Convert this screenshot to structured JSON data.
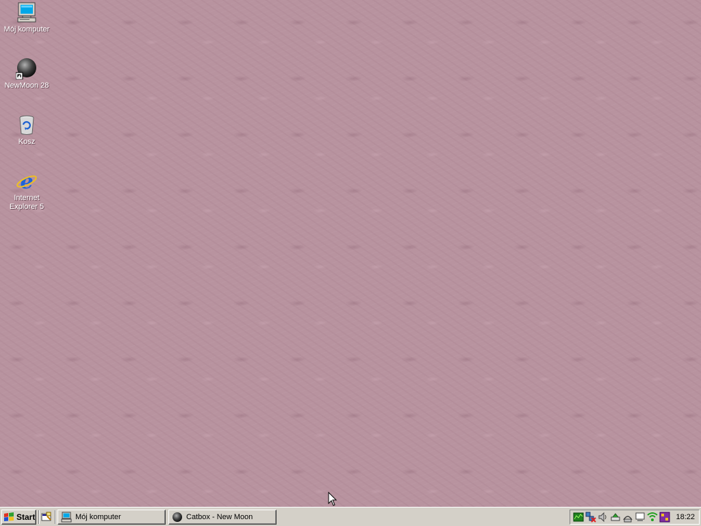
{
  "desktop": {
    "icons": [
      {
        "label": "Mój komputer",
        "icon": "my-computer-icon"
      },
      {
        "label": "NewMoon 28",
        "icon": "newmoon-shortcut-icon"
      },
      {
        "label": "Kosz",
        "icon": "recycle-bin-icon"
      },
      {
        "label": "Internet Explorer 5",
        "icon": "internet-explorer-icon"
      }
    ],
    "background_color": "#b8939f"
  },
  "taskbar": {
    "start_label": "Start",
    "quick_launch": [
      {
        "icon": "show-desktop-icon"
      }
    ],
    "tasks": [
      {
        "label": "Mój komputer",
        "icon": "my-computer-icon"
      },
      {
        "label": "Catbox - New Moon",
        "icon": "newmoon-icon"
      }
    ],
    "tray_icons": [
      "network-activity-icon",
      "network-disconnected-icon",
      "volume-icon",
      "usb-device-icon",
      "modem-icon",
      "display-icon",
      "wifi-signal-icon",
      "app-tray-icon"
    ],
    "clock": "18:22"
  },
  "colors": {
    "taskbar_face": "#d4d0c8",
    "accent": "#000080"
  }
}
